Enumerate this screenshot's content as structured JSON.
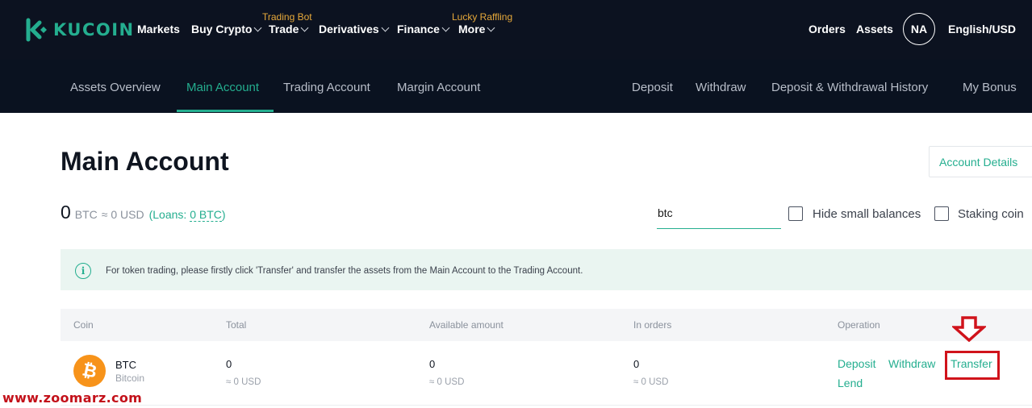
{
  "brand": {
    "name": "KUCOIN",
    "color": "#24ae8f"
  },
  "topnav": {
    "items": [
      {
        "label": "Markets",
        "dropdown": false,
        "tag": ""
      },
      {
        "label": "Buy Crypto",
        "dropdown": true,
        "tag": ""
      },
      {
        "label": "Trade",
        "dropdown": true,
        "tag": "Trading Bot"
      },
      {
        "label": "Derivatives",
        "dropdown": true,
        "tag": ""
      },
      {
        "label": "Finance",
        "dropdown": true,
        "tag": ""
      },
      {
        "label": "More",
        "dropdown": true,
        "tag": "Lucky Raffling"
      }
    ],
    "orders": "Orders",
    "assets": "Assets",
    "avatar_initials": "NA",
    "locale": "English/USD"
  },
  "subnav": {
    "tabs": [
      {
        "label": "Assets Overview",
        "active": false
      },
      {
        "label": "Main Account",
        "active": true
      },
      {
        "label": "Trading Account",
        "active": false
      },
      {
        "label": "Margin Account",
        "active": false
      }
    ],
    "links": [
      "Deposit",
      "Withdraw",
      "Deposit & Withdrawal History",
      "My Bonus"
    ]
  },
  "main": {
    "title": "Main Account",
    "account_details": "Account Details",
    "balance": {
      "amount": "0",
      "unit": "BTC",
      "usd": "≈ 0 USD",
      "loans_prefix": "(Loans:",
      "loans_value": "0 BTC",
      "loans_suffix": ")"
    },
    "search": {
      "value": "btc",
      "placeholder": ""
    },
    "hide_small": {
      "label": "Hide small balances",
      "checked": false
    },
    "staking": {
      "label": "Staking coin",
      "checked": false
    },
    "notice": "For token trading, please firstly click 'Transfer' and transfer the assets from the Main Account to the Trading Account."
  },
  "table": {
    "headers": [
      "Coin",
      "Total",
      "Available amount",
      "In orders",
      "Operation"
    ],
    "rows": [
      {
        "icon": "bitcoin-icon",
        "symbol": "BTC",
        "name": "Bitcoin",
        "total": "0",
        "total_usd": "≈ 0 USD",
        "available": "0",
        "available_usd": "≈ 0 USD",
        "in_orders": "0",
        "in_orders_usd": "≈ 0 USD",
        "ops": {
          "deposit": "Deposit",
          "withdraw": "Withdraw",
          "transfer": "Transfer",
          "lend": "Lend"
        }
      }
    ]
  },
  "annotation": {
    "color": "#d0131b"
  },
  "watermark": "www.zoomarz.com"
}
